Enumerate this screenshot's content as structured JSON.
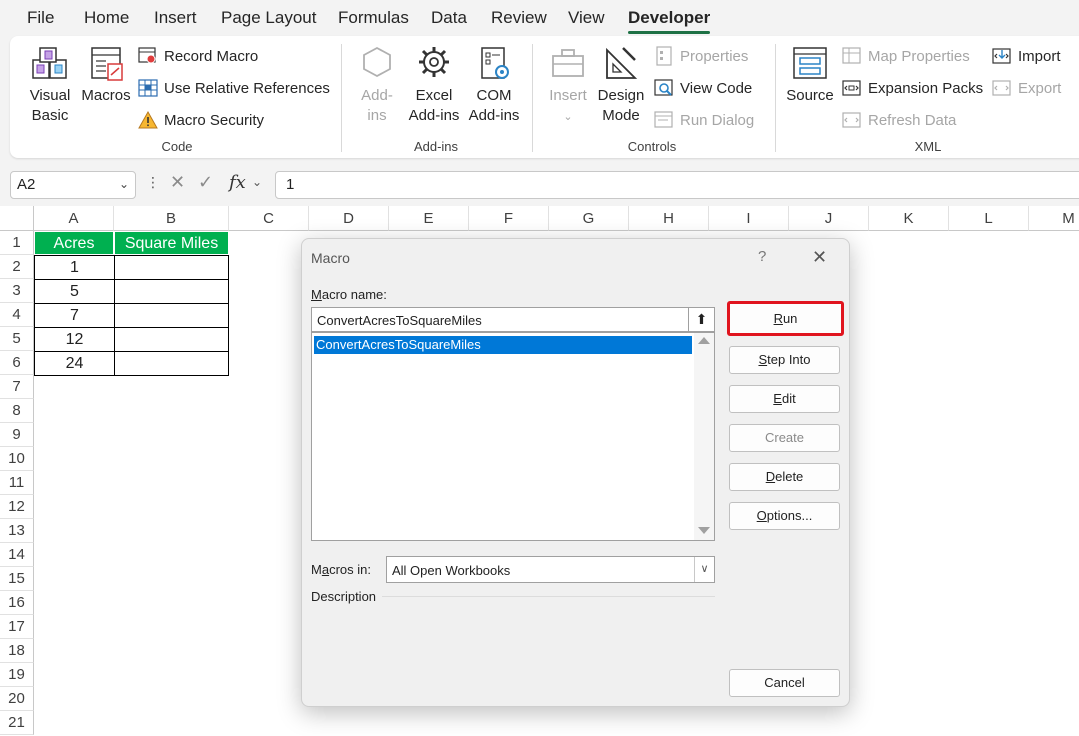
{
  "menu": {
    "tabs": [
      "File",
      "Home",
      "Insert",
      "Page Layout",
      "Formulas",
      "Data",
      "Review",
      "View",
      "Developer"
    ],
    "active": "Developer"
  },
  "ribbon": {
    "code": {
      "label": "Code",
      "visual_basic_line1": "Visual",
      "visual_basic_line2": "Basic",
      "macros": "Macros",
      "record_macro": "Record Macro",
      "use_relative_references": "Use Relative References",
      "macro_security": "Macro Security"
    },
    "addins": {
      "label": "Add-ins",
      "addins_line1": "Add-",
      "addins_line2": "ins",
      "excel_addins_line1": "Excel",
      "excel_addins_line2": "Add-ins",
      "com_addins_line1": "COM",
      "com_addins_line2": "Add-ins"
    },
    "controls": {
      "label": "Controls",
      "insert": "Insert",
      "design_mode_line1": "Design",
      "design_mode_line2": "Mode",
      "properties": "Properties",
      "view_code": "View Code",
      "run_dialog": "Run Dialog"
    },
    "xml": {
      "label": "XML",
      "source": "Source",
      "map_properties": "Map Properties",
      "expansion_packs": "Expansion Packs",
      "refresh_data": "Refresh Data",
      "import": "Import",
      "export": "Export"
    }
  },
  "formula_bar": {
    "name_box": "A2",
    "fx": "fx",
    "value": "1"
  },
  "sheet": {
    "columns": [
      "A",
      "B",
      "C",
      "D",
      "E",
      "F",
      "G",
      "H",
      "I",
      "J",
      "K",
      "L",
      "M"
    ],
    "rows": [
      "1",
      "2",
      "3",
      "4",
      "5",
      "6",
      "7",
      "8",
      "9",
      "10",
      "11",
      "12",
      "13",
      "14",
      "15",
      "16",
      "17",
      "18",
      "19",
      "20",
      "21"
    ],
    "table": {
      "headers": [
        "Acres",
        "Square Miles"
      ],
      "acres": [
        "1",
        "5",
        "7",
        "12",
        "24"
      ]
    }
  },
  "dialog": {
    "title": "Macro",
    "help": "?",
    "close": "✕",
    "macro_name_label_m": "M",
    "macro_name_label_rest": "acro name:",
    "macro_name_value": "ConvertAcresToSquareMiles",
    "macro_list": [
      "ConvertAcresToSquareMiles"
    ],
    "buttons": {
      "run_u": "R",
      "run_rest": "un",
      "step_u": "S",
      "step_rest": "tep Into",
      "edit_u": "E",
      "edit_rest": "dit",
      "create": "Create",
      "delete_u": "D",
      "delete_rest": "elete",
      "options_u": "O",
      "options_rest": "ptions...",
      "cancel": "Cancel"
    },
    "macros_in_label_pre": "M",
    "macros_in_label_u": "a",
    "macros_in_label_rest": "cros in:",
    "macros_in_value": "All Open Workbooks",
    "description_label": "Description"
  },
  "colors": {
    "accent_green": "#1e7145",
    "header_fill": "#00b050",
    "selection_blue": "#0078d7",
    "highlight_red": "#e0141e"
  }
}
